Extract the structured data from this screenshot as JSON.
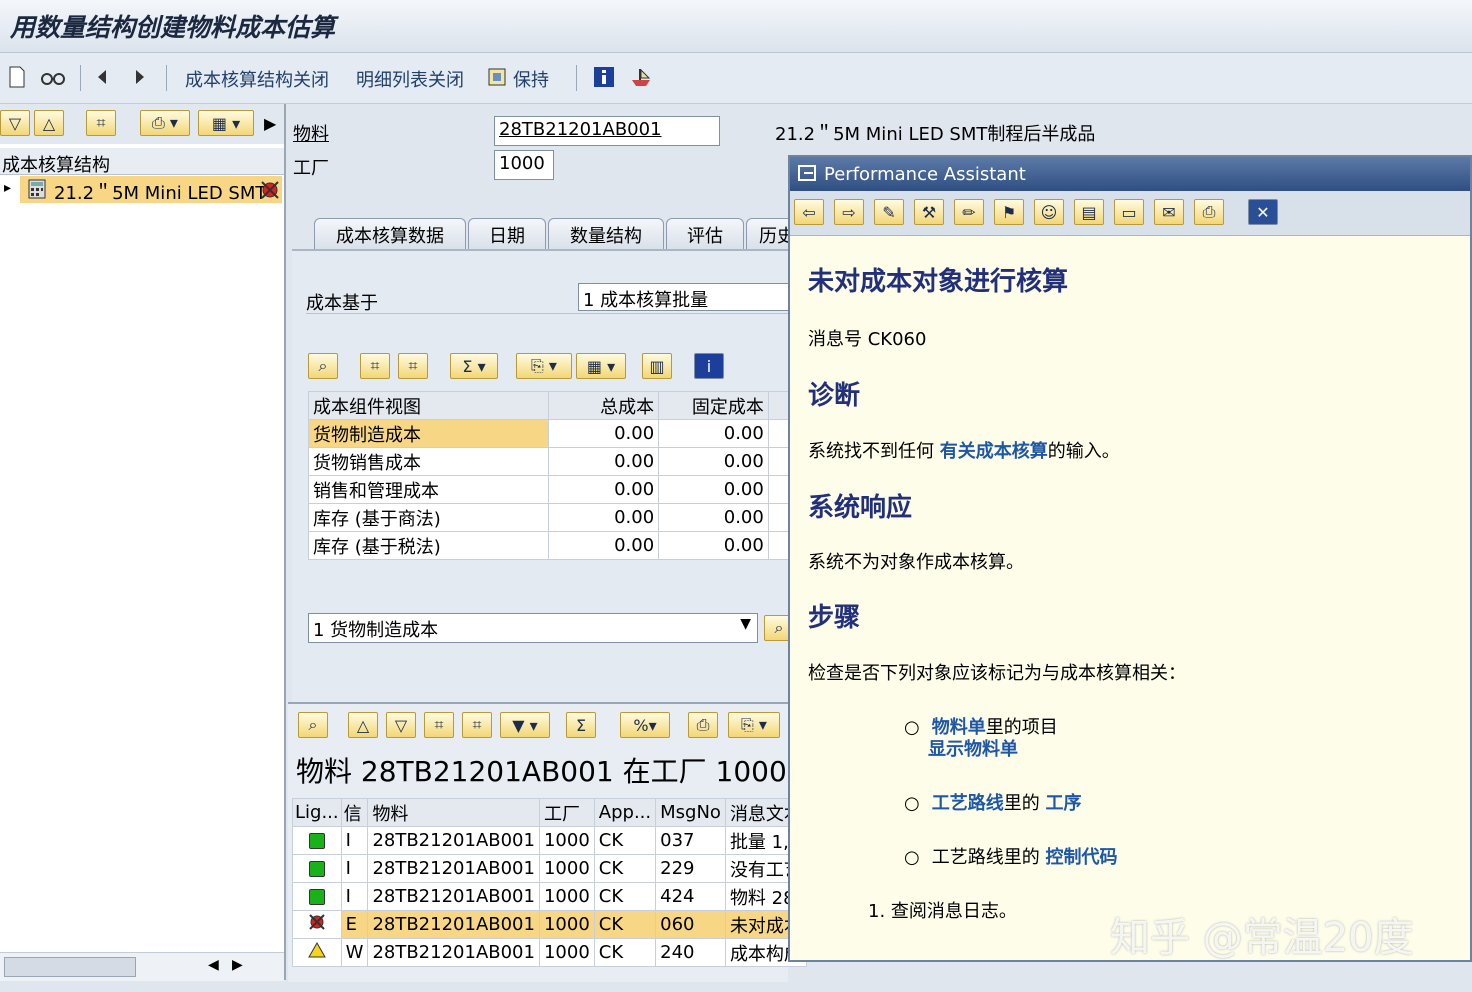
{
  "window": {
    "title": "用数量结构创建物料成本估算"
  },
  "toolbar": {
    "btn_cost_structure_close": "成本核算结构关闭",
    "btn_detail_list_close": "明细列表关闭",
    "btn_keep": "保持"
  },
  "left_panel": {
    "header": "成本核算结构",
    "tree_item": "21.2＂5M  Mini LED SMT"
  },
  "form": {
    "material_label": "物料",
    "material_value": "28TB21201AB001",
    "material_desc": "21.2＂5M  Mini LED SMT制程后半成品",
    "plant_label": "工厂",
    "plant_value": "1000"
  },
  "tabs": [
    "成本核算数据",
    "日期",
    "数量结构",
    "评估",
    "历史"
  ],
  "costing": {
    "based_on_label": "成本基于",
    "based_on_value": "1 成本核算批量",
    "table_headers": [
      "成本组件视图",
      "总成本",
      "固定成本"
    ],
    "rows": [
      {
        "name": "货物制造成本",
        "total": "0.00",
        "fixed": "0.00"
      },
      {
        "name": "货物销售成本",
        "total": "0.00",
        "fixed": "0.00"
      },
      {
        "name": "销售和管理成本",
        "total": "0.00",
        "fixed": "0.00"
      },
      {
        "name": "库存 (基于商法)",
        "total": "0.00",
        "fixed": "0.00"
      },
      {
        "name": "库存 (基于税法)",
        "total": "0.00",
        "fixed": "0.00"
      }
    ],
    "view_select": "1 货物制造成本"
  },
  "log": {
    "title": "物料 28TB21201AB001 在工厂 1000",
    "headers": [
      "Lig...",
      "信",
      "物料",
      "工厂",
      "App...",
      "MsgNo",
      "消息文本"
    ],
    "rows": [
      {
        "light": "green",
        "type": "I",
        "material": "28TB21201AB001",
        "plant": "1000",
        "app": "CK",
        "msgno": "037",
        "text": "批量 1,"
      },
      {
        "light": "green",
        "type": "I",
        "material": "28TB21201AB001",
        "plant": "1000",
        "app": "CK",
        "msgno": "229",
        "text": "没有工艺"
      },
      {
        "light": "green",
        "type": "I",
        "material": "28TB21201AB001",
        "plant": "1000",
        "app": "CK",
        "msgno": "424",
        "text": "物料 28"
      },
      {
        "light": "red",
        "type": "E",
        "material": "28TB21201AB001",
        "plant": "1000",
        "app": "CK",
        "msgno": "060",
        "text": "未对成本"
      },
      {
        "light": "yellow",
        "type": "W",
        "material": "28TB21201AB001",
        "plant": "1000",
        "app": "CK",
        "msgno": "240",
        "text": "成本构成"
      }
    ]
  },
  "assistant": {
    "window_title": "Performance Assistant",
    "heading": "未对成本对象进行核算",
    "msg_no": "消息号  CK060",
    "diag_title": "诊断",
    "diag_pre": "系统找不到任何 ",
    "diag_link": "有关成本核算",
    "diag_post": "的输入。",
    "resp_title": "系统响应",
    "resp_text": "系统不为对象作成本核算。",
    "steps_title": "步骤",
    "steps_intro": "检查是否下列对象应该标记为与成本核算相关：",
    "bullet1_link": "物料单",
    "bullet1_text": "里的项目",
    "bullet1_link2": "显示物料单",
    "bullet2_link": "工艺路线",
    "bullet2_text": "里的 ",
    "bullet2_link2": "工序",
    "bullet3_text": "工艺路线里的 ",
    "bullet3_link": "控制代码",
    "step1": "1. 查阅消息日志。"
  },
  "watermark": "知乎 @常温20度"
}
